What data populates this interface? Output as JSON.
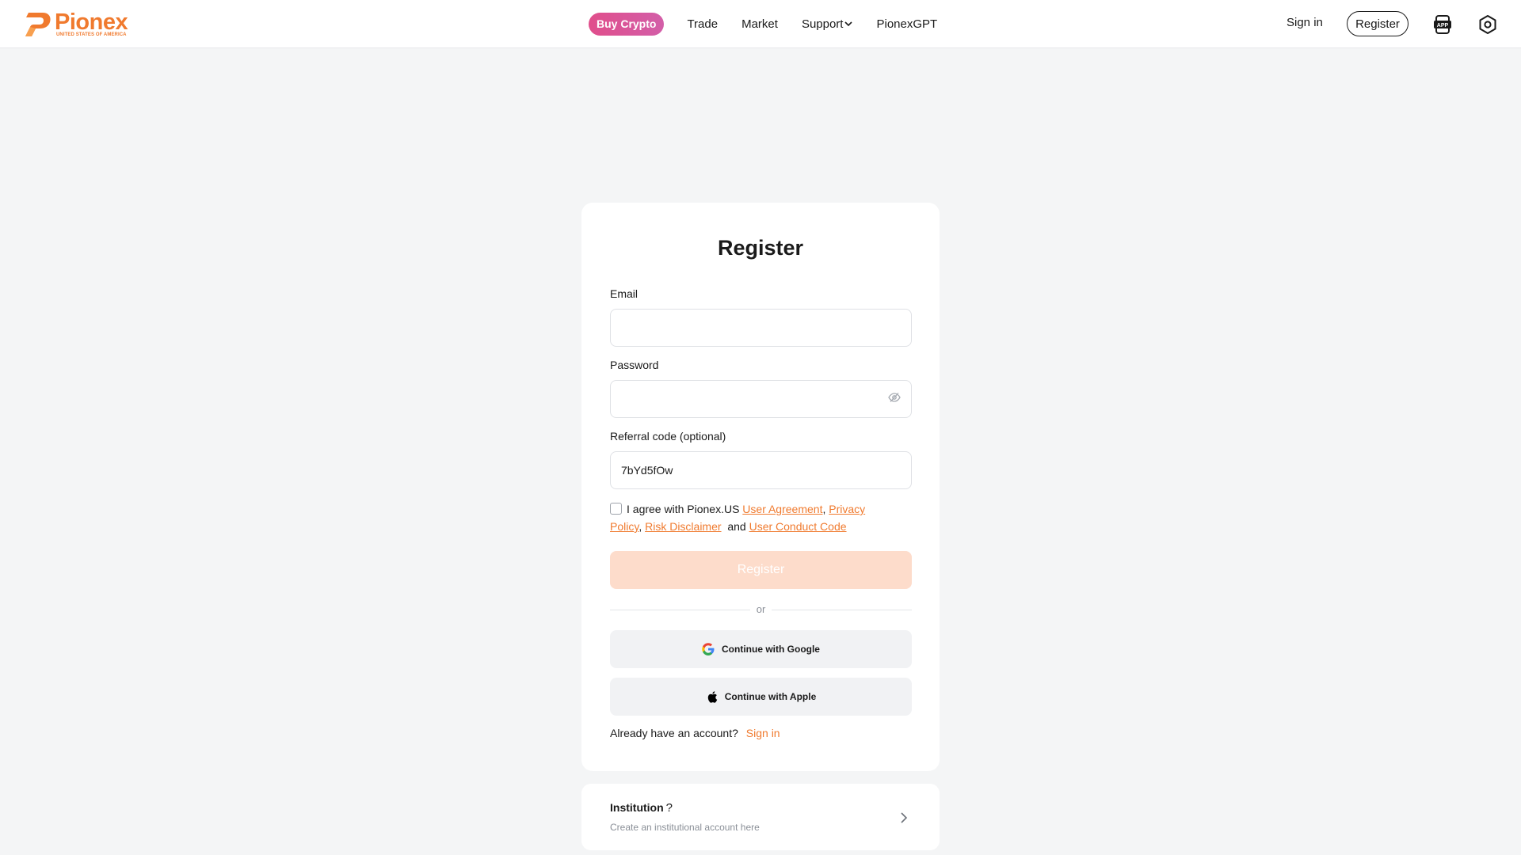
{
  "brand": {
    "name": "Pionex",
    "subtitle": "UNITED STATES OF AMERICA",
    "accent": "#f07a2e"
  },
  "nav": {
    "buy_crypto": "Buy Crypto",
    "items": [
      "Trade",
      "Market",
      "Support",
      "PionexGPT"
    ]
  },
  "header_right": {
    "sign_in": "Sign in",
    "register": "Register",
    "app_icon": "app-download-icon",
    "settings_icon": "gear-icon"
  },
  "form": {
    "title": "Register",
    "email_label": "Email",
    "email_value": "",
    "password_label": "Password",
    "password_value": "",
    "referral_label": "Referral code (optional)",
    "referral_value": "7bYd5fOw",
    "agree_prefix": "I agree with Pionex.US",
    "links": [
      "User Agreement",
      "Privacy Policy",
      "Risk Disclaimer",
      "User Conduct Code"
    ],
    "agree_and": "and",
    "submit": "Register",
    "or": "or",
    "google": "Continue with Google",
    "apple": "Continue with Apple",
    "already": "Already have an account?",
    "sign_in": "Sign in"
  },
  "institution": {
    "title": "Institution",
    "question": "?",
    "subtitle": "Create an institutional account here"
  }
}
